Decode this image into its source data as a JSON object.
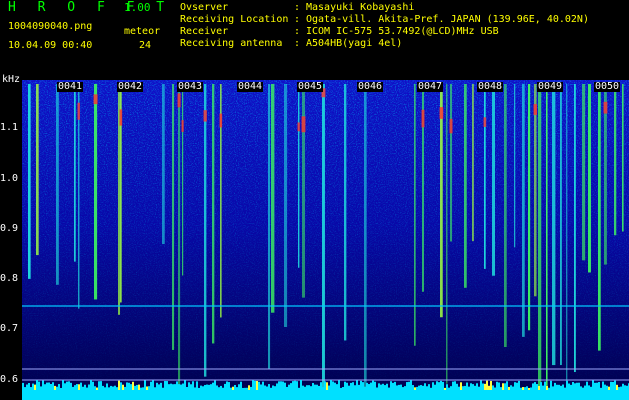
{
  "header": {
    "app_name": "H R O F F T",
    "version": "1.00",
    "file_name": "1004090040.png",
    "datetime": "10.04.09 00:40",
    "meteor_label": "meteor",
    "meteor_count": "24",
    "info": [
      {
        "label": "Ovserver",
        "value": "Masayuki Kobayashi"
      },
      {
        "label": "Receiving Location",
        "value": "Ogata-vill. Akita-Pref. JAPAN (139.96E, 40.02N)"
      },
      {
        "label": "Receiver",
        "value": "ICOM IC-575 53.7492(@LCD)MHz USB"
      },
      {
        "label": "Receiving antenna",
        "value": "A504HB(yagi 4el)"
      }
    ],
    "colon": ":"
  },
  "axis": {
    "unit": "kHz",
    "ticks": [
      "1.1",
      "1.0",
      "0.9",
      "0.8",
      "0.7",
      "0.6"
    ]
  },
  "time_marks": [
    "0041",
    "0042",
    "0043",
    "0044",
    "0045",
    "0046",
    "0047",
    "0048",
    "0049",
    "0050"
  ],
  "colors": {
    "brand": "#00ff00",
    "info": "#ffff00",
    "tick": "#ffffff",
    "time_mark": "#ffffff",
    "background_noise": "#0000aa",
    "baseline_noise": "#00e0ff",
    "reference_line": "#00c8ff"
  }
}
